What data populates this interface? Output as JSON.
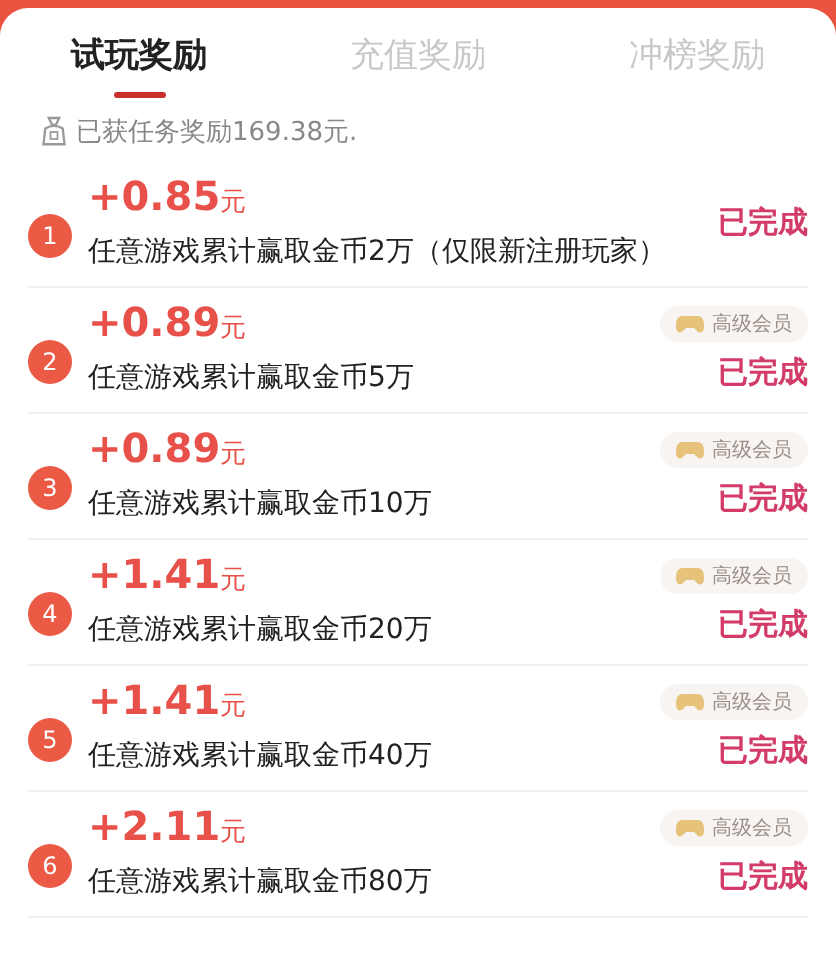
{
  "tabs": [
    {
      "label": "试玩奖励",
      "selected": true
    },
    {
      "label": "充值奖励",
      "selected": false
    },
    {
      "label": "冲榜奖励",
      "selected": false
    }
  ],
  "summary": "已获任务奖励169.38元.",
  "tasks": [
    {
      "index": "1",
      "amount": "+0.85",
      "unit": "元",
      "description": "任意游戏累计赢取金币2万（仅限新注册玩家）",
      "status": "已完成"
    },
    {
      "index": "2",
      "amount": "+0.89",
      "unit": "元",
      "description": "任意游戏累计赢取金币5万",
      "badge": "高级会员",
      "status": "已完成"
    },
    {
      "index": "3",
      "amount": "+0.89",
      "unit": "元",
      "description": "任意游戏累计赢取金币10万",
      "badge": "高级会员",
      "status": "已完成"
    },
    {
      "index": "4",
      "amount": "+1.41",
      "unit": "元",
      "description": "任意游戏累计赢取金币20万",
      "badge": "高级会员",
      "status": "已完成"
    },
    {
      "index": "5",
      "amount": "+1.41",
      "unit": "元",
      "description": "任意游戏累计赢取金币40万",
      "badge": "高级会员",
      "status": "已完成"
    },
    {
      "index": "6",
      "amount": "+2.11",
      "unit": "元",
      "description": "任意游戏累计赢取金币80万",
      "badge": "高级会员",
      "status": "已完成"
    }
  ]
}
